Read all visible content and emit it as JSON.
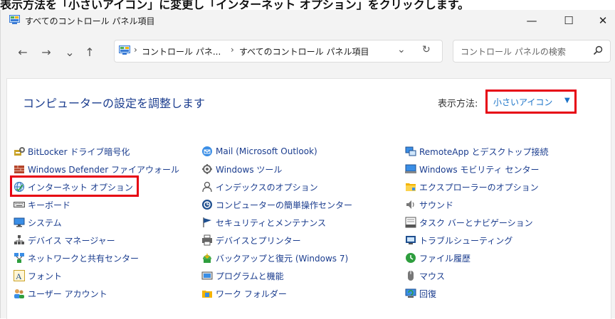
{
  "caption": "表示方法を「小さいアイコン」に変更し「インターネット オプション」をクリックします。",
  "window": {
    "title": "すべてのコントロール パネル項目",
    "minimize_glyph": "—",
    "maximize_glyph": "☐",
    "close_glyph": "✕"
  },
  "nav": {
    "back": "←",
    "forward": "→",
    "recent": "⌄",
    "up": "↑"
  },
  "address": {
    "crumbs": [
      "コントロール パネ...",
      "すべてのコントロール パネル項目"
    ],
    "separator": "›",
    "dropdown": "⌄",
    "refresh": "↻"
  },
  "search": {
    "placeholder": "コントロール パネルの検索"
  },
  "main": {
    "heading": "コンピューターの設定を調整します",
    "view_label": "表示方法:",
    "view_value": "小さいアイコン",
    "view_caret": "▼"
  },
  "items": {
    "col1": [
      "BitLocker ドライブ暗号化",
      "Windows Defender ファイアウォール",
      "インターネット オプション",
      "キーボード",
      "システム",
      "デバイス マネージャー",
      "ネットワークと共有センター",
      "フォント",
      "ユーザー アカウント"
    ],
    "col2": [
      "Mail (Microsoft Outlook)",
      "Windows ツール",
      "インデックスのオプション",
      "コンピューターの簡単操作センター",
      "セキュリティとメンテナンス",
      "デバイスとプリンター",
      "バックアップと復元 (Windows 7)",
      "プログラムと機能",
      "ワーク フォルダー"
    ],
    "col3": [
      "RemoteApp とデスクトップ接続",
      "Windows モビリティ センター",
      "エクスプローラーのオプション",
      "サウンド",
      "タスク バーとナビゲーション",
      "トラブルシューティング",
      "ファイル履歴",
      "マウス",
      "回復"
    ]
  },
  "colors": {
    "link": "#1a3c8e",
    "accent": "#1a73c8",
    "highlight": "#e60012"
  }
}
